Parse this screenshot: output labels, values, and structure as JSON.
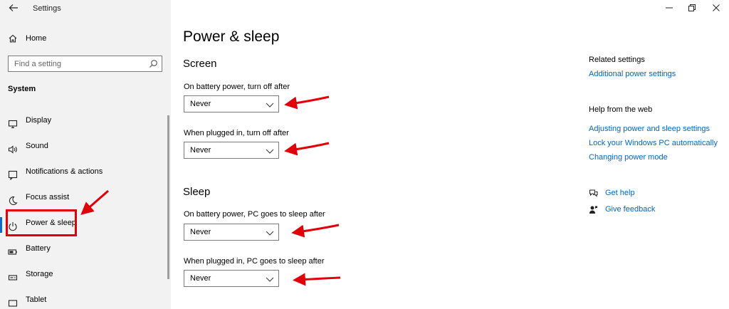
{
  "window": {
    "app_title": "Settings",
    "back_icon": "arrow-left-icon",
    "minimize_icon": "minimize-icon",
    "restore_icon": "restore-icon",
    "close_icon": "close-icon"
  },
  "sidebar": {
    "home_label": "Home",
    "search_placeholder": "Find a setting",
    "section_title": "System",
    "items": [
      {
        "label": "Display",
        "icon": "display-icon"
      },
      {
        "label": "Sound",
        "icon": "speaker-icon"
      },
      {
        "label": "Notifications & actions",
        "icon": "notification-icon"
      },
      {
        "label": "Focus assist",
        "icon": "moon-icon"
      },
      {
        "label": "Power & sleep",
        "icon": "power-icon",
        "active": true
      },
      {
        "label": "Battery",
        "icon": "battery-icon"
      },
      {
        "label": "Storage",
        "icon": "storage-icon"
      },
      {
        "label": "Tablet",
        "icon": "tablet-icon"
      }
    ]
  },
  "main": {
    "title": "Power & sleep",
    "screen": {
      "title": "Screen",
      "battery_label": "On battery power, turn off after",
      "battery_value": "Never",
      "plugged_label": "When plugged in, turn off after",
      "plugged_value": "Never"
    },
    "sleep": {
      "title": "Sleep",
      "battery_label": "On battery power, PC goes to sleep after",
      "battery_value": "Never",
      "plugged_label": "When plugged in, PC goes to sleep after",
      "plugged_value": "Never"
    }
  },
  "related": {
    "title": "Related settings",
    "links": [
      "Additional power settings"
    ]
  },
  "help": {
    "title": "Help from the web",
    "links": [
      "Adjusting power and sleep settings",
      "Lock your Windows PC automatically",
      "Changing power mode"
    ],
    "get_help": "Get help",
    "give_feedback": "Give feedback"
  },
  "annotations": {
    "arrow_color": "#e0000a",
    "highlight_color": "#e0000a"
  },
  "colors": {
    "accent": "#0067c0",
    "sidebar_bg": "#f2f2f2"
  }
}
